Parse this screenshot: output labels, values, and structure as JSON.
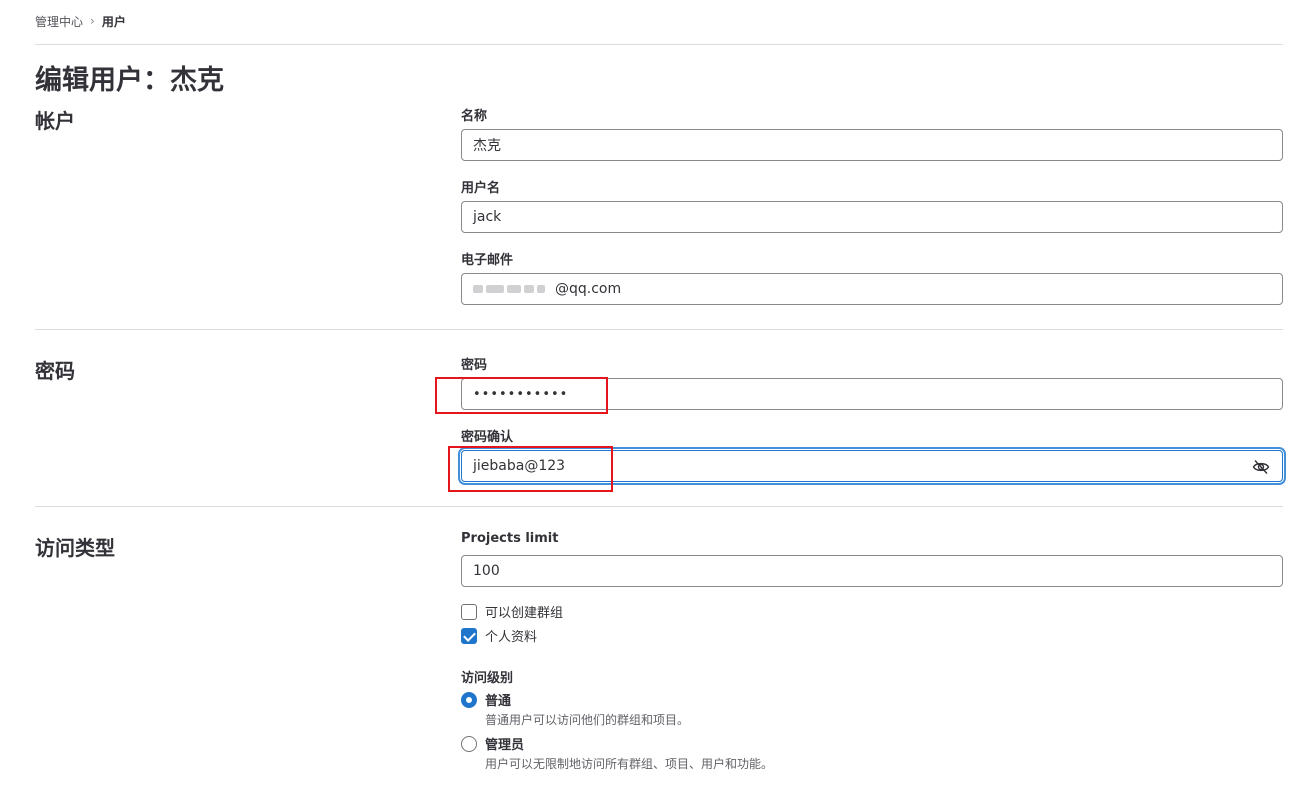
{
  "breadcrumb": {
    "parent": "管理中心",
    "separator": "›",
    "current": "用户"
  },
  "page_title": "编辑用户：杰克",
  "sections": {
    "account": "帐户",
    "password": "密码",
    "access": "访问类型"
  },
  "fields": {
    "name": {
      "label": "名称",
      "value": "杰克"
    },
    "username": {
      "label": "用户名",
      "value": "jack"
    },
    "email": {
      "label": "电子邮件",
      "value_visible": "@qq.com"
    },
    "password": {
      "label": "密码",
      "value": "•••••••••••"
    },
    "password_confirm": {
      "label": "密码确认",
      "value": "jiebaba@123"
    },
    "projects_limit": {
      "label": "Projects limit",
      "value": "100"
    }
  },
  "checkboxes": [
    {
      "label": "可以创建群组",
      "checked": false
    },
    {
      "label": "个人资料",
      "checked": true
    }
  ],
  "access_level": {
    "label": "访问级别",
    "options": [
      {
        "label": "普通",
        "help": "普通用户可以访问他们的群组和项目。",
        "selected": true
      },
      {
        "label": "管理员",
        "help": "用户可以无限制地访问所有群组、项目、用户和功能。",
        "selected": false
      }
    ]
  },
  "icons": {
    "password_toggle": "eye-off-icon"
  },
  "colors": {
    "accent": "#1f75cb",
    "highlight": "#e4161b",
    "text": "#333238",
    "border": "#89888d"
  }
}
